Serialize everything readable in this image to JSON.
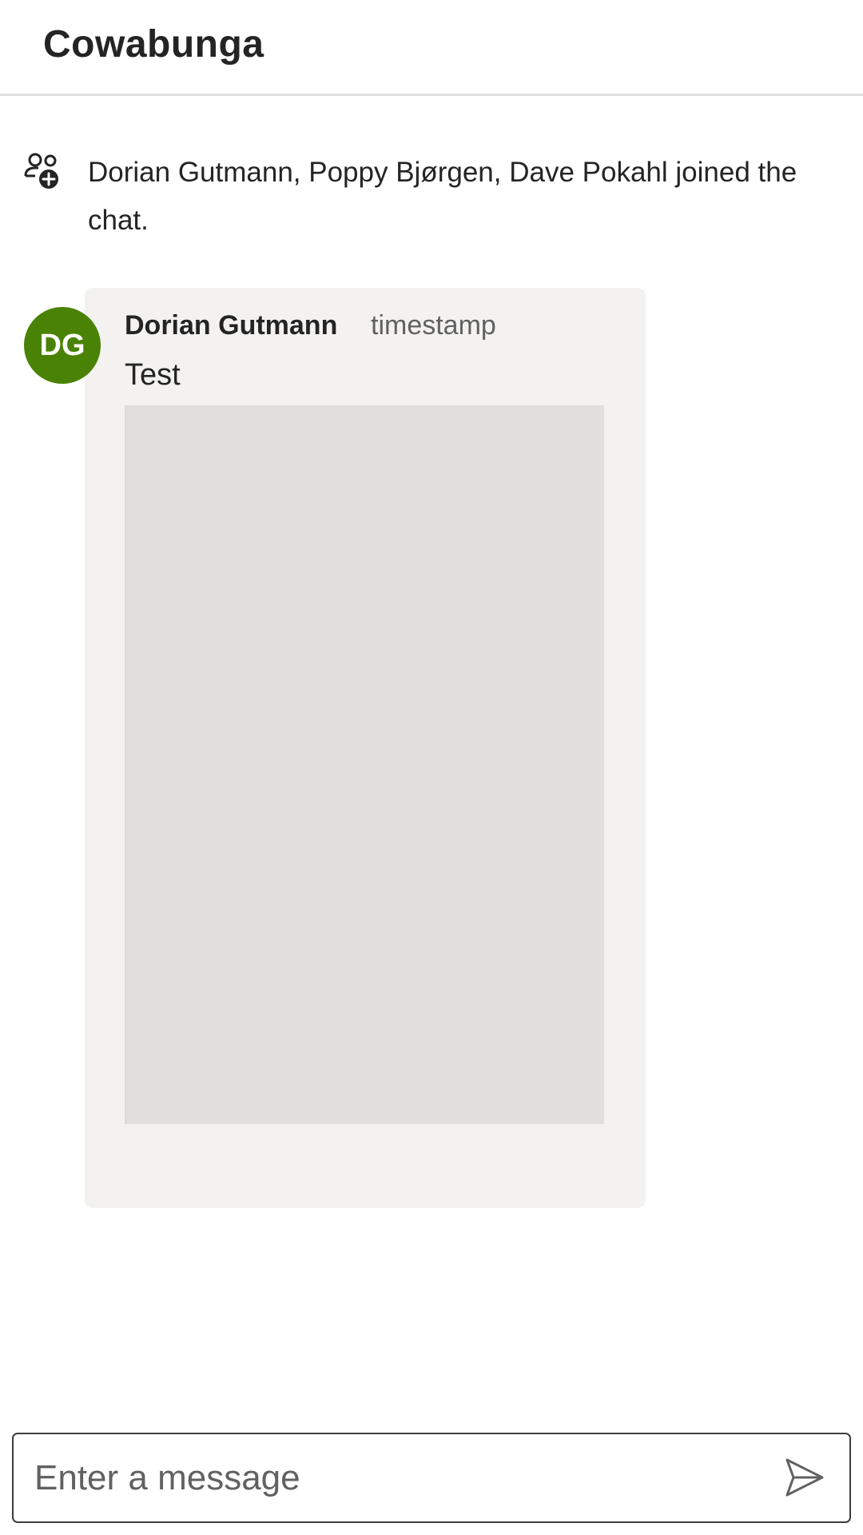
{
  "header": {
    "title": "Cowabunga"
  },
  "system_message": {
    "icon": "person-add-icon",
    "text": "Dorian Gutmann, Poppy Bjørgen, Dave Pokahl joined the chat."
  },
  "message": {
    "avatar_initials": "DG",
    "avatar_color": "#498205",
    "sender": "Dorian Gutmann",
    "timestamp": "timestamp",
    "text": "Test"
  },
  "composer": {
    "placeholder": "Enter a message",
    "value": "",
    "send_icon": "send-icon"
  }
}
